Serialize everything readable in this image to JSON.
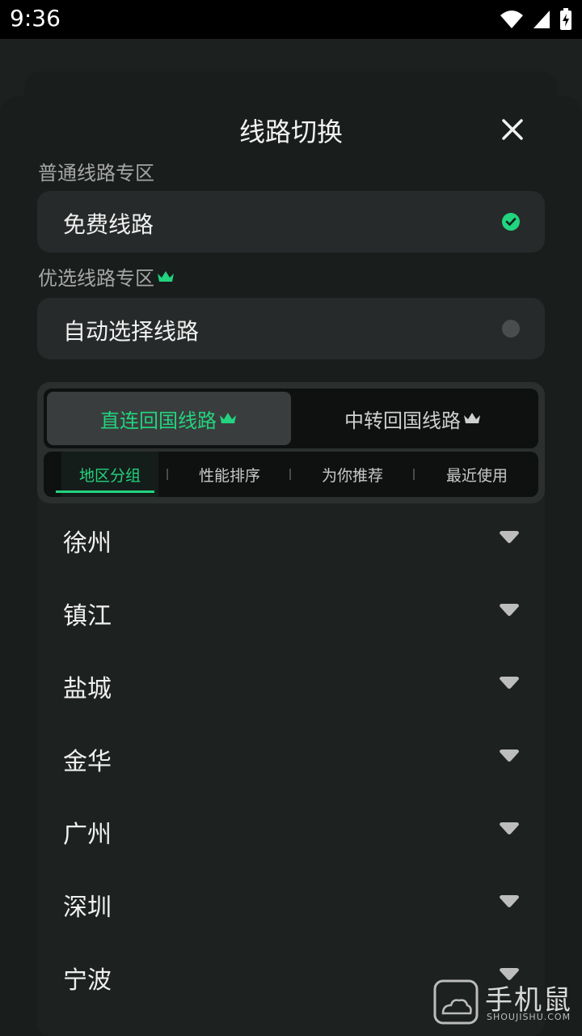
{
  "status": {
    "time": "9:36"
  },
  "header": {
    "title": "线路切换"
  },
  "sections": {
    "normal": {
      "label": "普通线路专区",
      "option": "免费线路",
      "selected": true
    },
    "premium": {
      "label": "优选线路专区",
      "option": "自动选择线路",
      "selected": false
    }
  },
  "tabs": [
    {
      "label": "直连回国线路",
      "active": true
    },
    {
      "label": "中转回国线路",
      "active": false
    }
  ],
  "subtabs": [
    {
      "label": "地区分组",
      "active": true
    },
    {
      "label": "性能排序",
      "active": false
    },
    {
      "label": "为你推荐",
      "active": false
    },
    {
      "label": "最近使用",
      "active": false
    }
  ],
  "cities": [
    "徐州",
    "镇江",
    "盐城",
    "金华",
    "广州",
    "深圳",
    "宁波"
  ],
  "watermark": {
    "brand": "手机鼠",
    "site": "SHOUJISHU.COM"
  },
  "colors": {
    "accent": "#22d37f",
    "background": "#191d1c",
    "card": "#272a2a"
  }
}
